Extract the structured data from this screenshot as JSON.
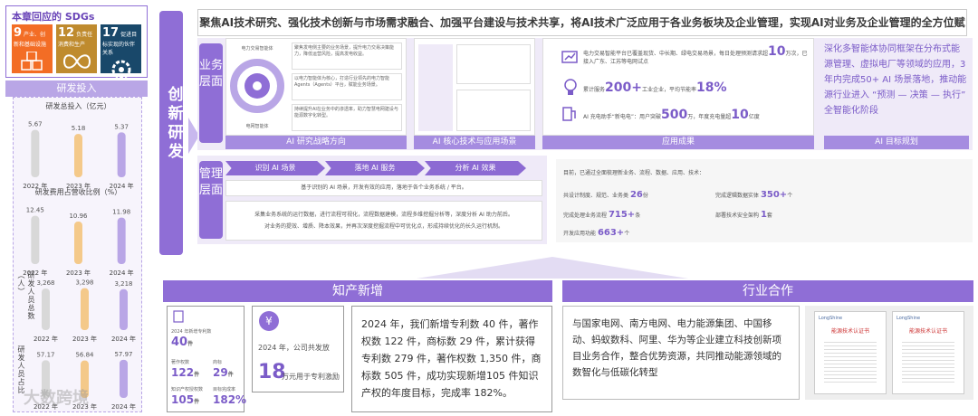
{
  "sdg": {
    "title": "本章回应的 SDGs",
    "goals": [
      {
        "num": "9",
        "label": "产业、创新和基础设施",
        "color": "#f36d25",
        "icon": "cubes-icon"
      },
      {
        "num": "12",
        "label": "负责任消费和生产",
        "color": "#bf8b2e",
        "icon": "infinity-icon"
      },
      {
        "num": "17",
        "label": "促进目标实现的伙伴关系",
        "color": "#19486a",
        "icon": "flower-icon"
      }
    ]
  },
  "rd": {
    "title": "研发投入",
    "people_label": "研发人员总数（人）",
    "ratio_label": "研发人员占比"
  },
  "chart_data": [
    {
      "type": "bar",
      "title": "研发总投入（亿元）",
      "categories": [
        "2022 年",
        "2023 年",
        "2024 年"
      ],
      "values": [
        5.67,
        5.18,
        5.37
      ],
      "value_labels": [
        "5.67",
        "5.18",
        "5.37"
      ],
      "ylim": [
        0,
        6.5
      ]
    },
    {
      "type": "bar",
      "title": "研发费用占营收比例（%）",
      "categories": [
        "2022 年",
        "2023 年",
        "2024 年"
      ],
      "values": [
        12.45,
        10.96,
        11.98
      ],
      "value_labels": [
        "12.45",
        "10.96",
        "11.98"
      ],
      "ylim": [
        0,
        14
      ]
    },
    {
      "type": "bar",
      "title": "研发人员总数（人）",
      "categories": [
        "2022 年",
        "2023 年",
        "2024 年"
      ],
      "values": [
        3268,
        3298,
        3218
      ],
      "value_labels": [
        "3,268",
        "3,298",
        "3,218"
      ],
      "ylim": [
        0,
        3700
      ]
    },
    {
      "type": "bar",
      "title": "研发人员占比",
      "categories": [
        "2022 年",
        "2023 年",
        "2024 年"
      ],
      "values": [
        57.17,
        56.84,
        57.97
      ],
      "value_labels": [
        "57.17",
        "56.84",
        "57.97"
      ],
      "ylim": [
        0,
        66
      ]
    }
  ],
  "bar_colors": [
    "#d8d8d8",
    "#f4c98a",
    "#b9a6e6"
  ],
  "innovation": "创新研发",
  "headline": "聚焦AI技术研究、强化技术创新与市场需求融合、加强平台建设与技术共享，将AI技术广泛应用于各业务板块及企业管理，实现AI对业务及企业管理的全方位赋能",
  "business": {
    "label": "业务层面",
    "strategy_bar": "AI 研究战略方向",
    "strategy_items": [
      "聚焦发电侧主要的业务场景，提升电力交易决策能力，降低运营风险，提高发电收益。",
      "以电力智能体为核心，打造行业领先的电力智能Agents（Agents）平台，赋能业务场景。",
      "持续提升AI在业务中的渗透率，助力智慧电网建设与能源数字化转型。"
    ],
    "ring_labels": [
      "电力交易智能体",
      "智能运营平台",
      "电网智能体"
    ],
    "tech_bar": "AI 核心技术与应用场景",
    "results_bar": "应用成果",
    "results": [
      {
        "text": "电力交易智能平台已覆盖现货、中长期、绿电交易场景，每日处理预测请求超",
        "value": "10",
        "unit": "万次，已接入广东、江苏等电网试点",
        "icon": "chart-icon"
      },
      {
        "text": "累计服务",
        "value": "200+",
        "unit": "工业企业，平均节能率",
        "value2": "18%",
        "icon": "bulb-icon"
      },
      {
        "text": "AI 充电助手“新电电”：用户突破",
        "value": "500",
        "unit": "万，年度充电量超",
        "value2": "10",
        "unit2": "亿度",
        "icon": "ev-icon"
      }
    ],
    "goal_text": "深化多智能体协同框架在分布式能源管理、虚拟电厂等领域的应用，3 年内完成50+ AI 场景落地，推动能源行业进入 “预测 — 决策 — 执行” 全智能化阶段",
    "goal_bar": "AI 目标规划"
  },
  "management": {
    "label": "管理层面",
    "steps": [
      "识别 AI 场景",
      "落地 AI 服务",
      "分析 AI 效果"
    ],
    "line1": "基于识别的 AI 场景，开发有效的应用，落地于各个业务系统 / 平台。",
    "line2": "采集业务系统的运行数据，进行流程可视化，流程数据建模，流程多维挖掘分析等，深度分析 AI 助力前后。",
    "line3": "对业务的提效、增质、降本效果，并再次深度挖掘流程中可优化点，形成持续优化的长久运行机制。",
    "stats_intro": "目前，已通过全面梳理新业务、流程、数据、应用、技术：",
    "stats": [
      {
        "label": "共设计制度、规范、业务类",
        "value": "26",
        "unit": "份"
      },
      {
        "label": "完成逻辑数据实体",
        "value": "350+",
        "unit": "个"
      },
      {
        "label": "完成处理业务流程",
        "value": "715+",
        "unit": "条"
      },
      {
        "label": "部署技术安全架构",
        "value": "1",
        "unit": "套"
      },
      {
        "label": "开发应用功能",
        "value": "663+",
        "unit": "个"
      }
    ]
  },
  "ip": {
    "title": "知产新增",
    "year_label": "2024 年新增专利数",
    "patents": "40",
    "patents_unit": "件",
    "mini": [
      {
        "label": "著作权数",
        "value": "122",
        "unit": "件"
      },
      {
        "label": "商标",
        "value": "29",
        "unit": "件"
      },
      {
        "label": "知识产权授权数",
        "value": "105",
        "unit": "件"
      },
      {
        "label": "目标完成率",
        "value": "182%",
        "unit": ""
      }
    ],
    "reward_text": "2024 年，公司共发放",
    "reward_value": "18",
    "reward_unit": "万元用于专利激励",
    "summary": "2024 年，我们新增专利数 40 件，著作权数 122 件，商标数 29 件，累计获得专利数 279 件，著作权数 1,350 件，商标数 505 件，成功实现新增105 件知识产权的年度目标，完成率 182%。"
  },
  "coop": {
    "title": "行业合作",
    "text": "与国家电网、南方电网、电力能源集团、中国移动、蚂蚁数科、阿里、华为等企业建立科技创新项目业务合作，整合优势资源，共同推动能源领域的数智化与低碳化转型",
    "cert_title": "能源技术认证书",
    "cert_brand": "LongShine"
  },
  "watermark": "大数跨境"
}
